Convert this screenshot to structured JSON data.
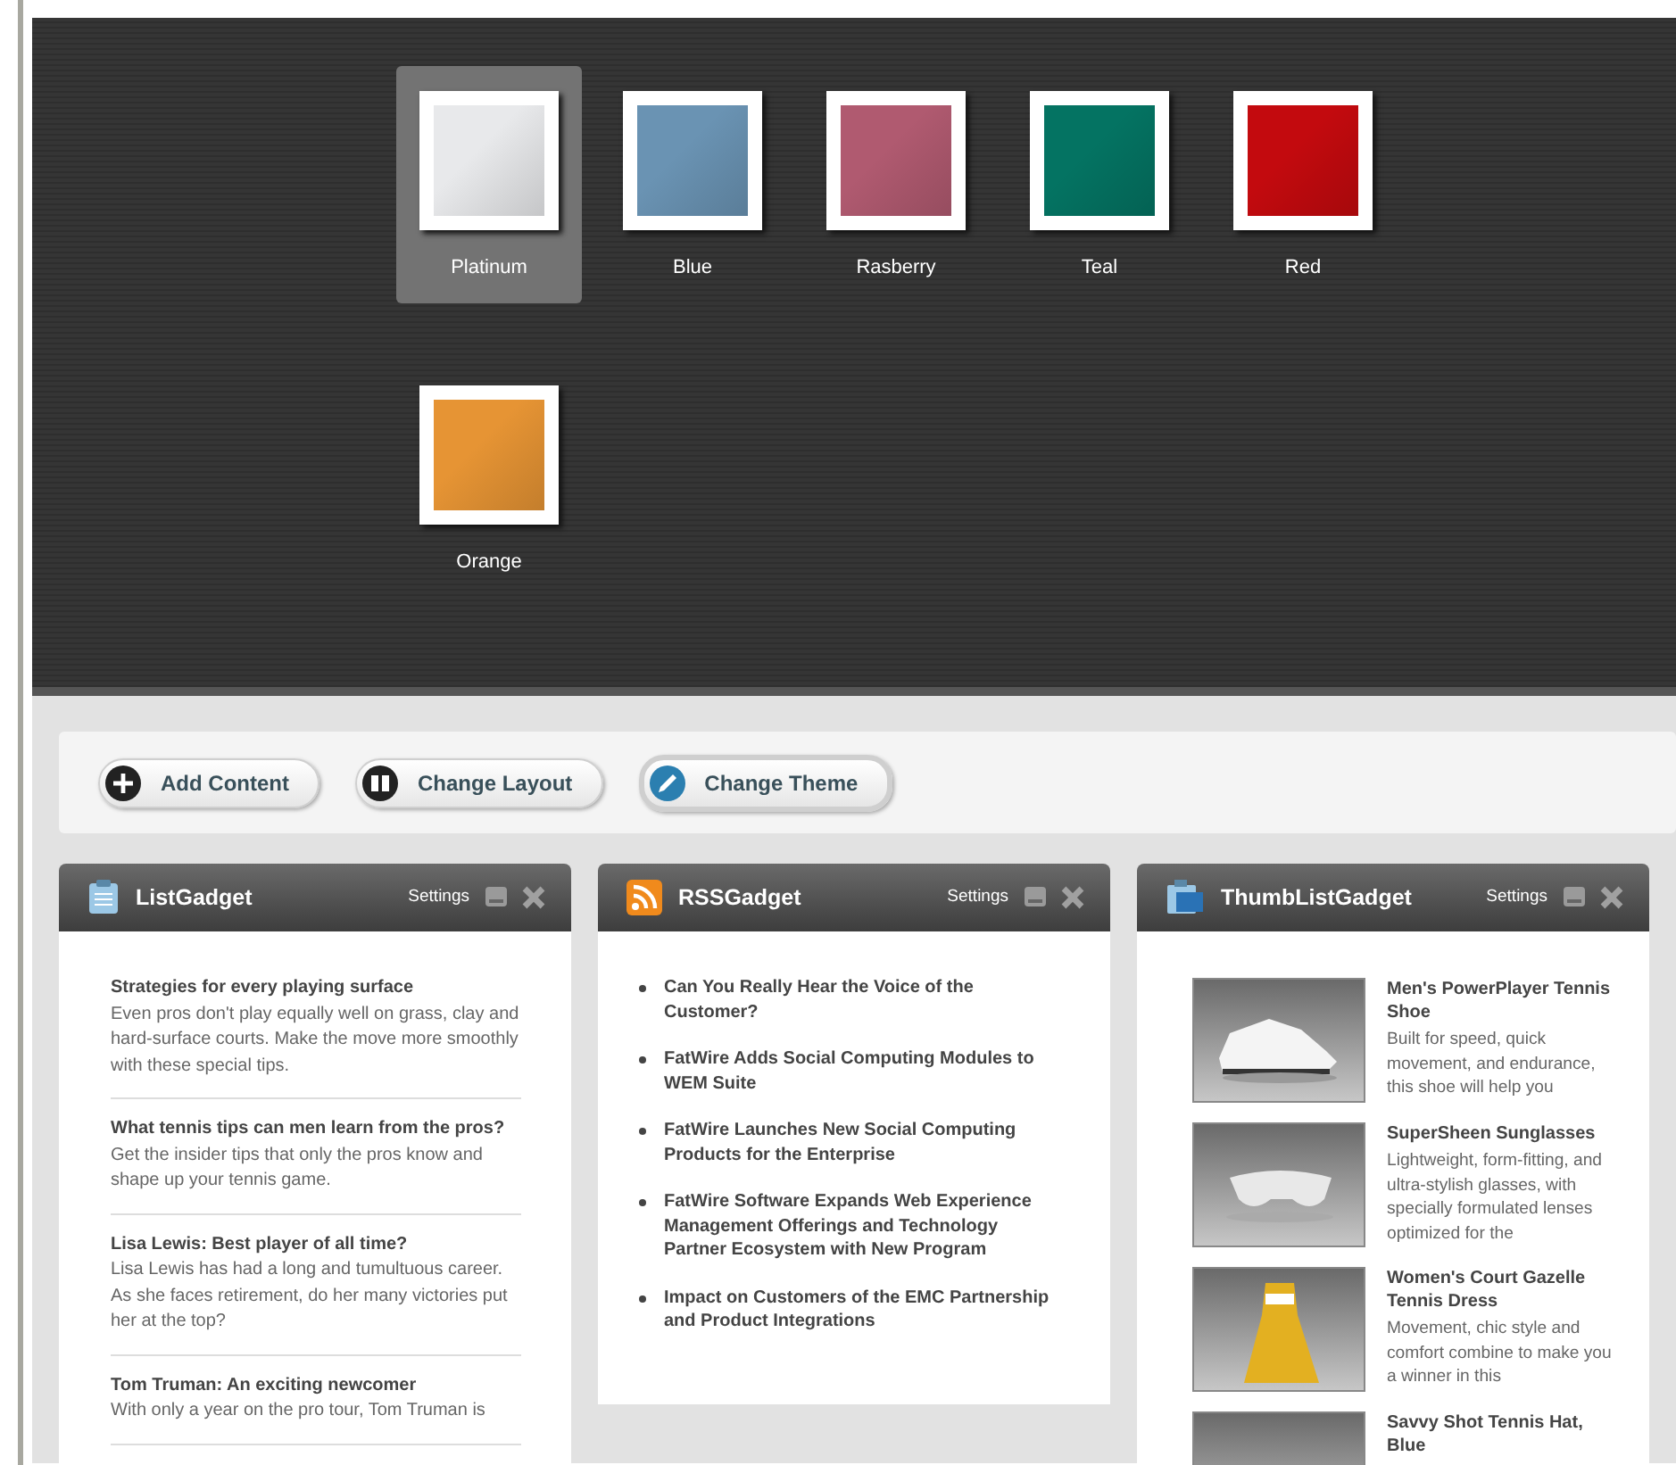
{
  "themes": [
    {
      "label": "Platinum",
      "color": "#e8e9eb",
      "selected": true
    },
    {
      "label": "Blue",
      "color": "#6a93b3",
      "selected": false
    },
    {
      "label": "Rasberry",
      "color": "#b05a70",
      "selected": false
    },
    {
      "label": "Teal",
      "color": "#047362",
      "selected": false
    },
    {
      "label": "Red",
      "color": "#c30a0e",
      "selected": false
    },
    {
      "label": "Orange",
      "color": "#e69434",
      "selected": false
    }
  ],
  "toolbar": [
    {
      "label": "Add Content",
      "selected": false
    },
    {
      "label": "Change Layout",
      "selected": false
    },
    {
      "label": "Change Theme",
      "selected": true
    }
  ],
  "gadgets": [
    {
      "kind": "list",
      "title": "ListGadget",
      "settings": "Settings",
      "items": [
        {
          "title": "Strategies for every playing surface",
          "text": "Even pros don't play equally well on grass, clay and hard-surface courts. Make the move more smoothly with these special tips."
        },
        {
          "title": "What tennis tips can men learn from the pros?",
          "text": "Get the insider tips that only the pros know and shape up your tennis game."
        },
        {
          "title": "Lisa Lewis: Best player of all time?",
          "text": "Lisa Lewis has had a long and tumultuous career. As she faces retirement, do her many victories put her at the top?"
        },
        {
          "title": "Tom Truman: An exciting newcomer",
          "text": "With only a year on the pro tour, Tom Truman is"
        }
      ]
    },
    {
      "kind": "rss",
      "title": "RSSGadget",
      "settings": "Settings",
      "items": [
        {
          "title": "Can You Really Hear the Voice of the Customer?"
        },
        {
          "title": "FatWire Adds Social Computing Modules to WEM Suite"
        },
        {
          "title": "FatWire Launches New Social Computing Products for the Enterprise"
        },
        {
          "title": "FatWire Software Expands Web Experience Management Offerings and Technology Partner Ecosystem with New Program"
        },
        {
          "title": "Impact on Customers of the EMC Partnership and Product Integrations"
        }
      ]
    },
    {
      "kind": "thumbs",
      "title": "ThumbListGadget",
      "settings": "Settings",
      "items": [
        {
          "title": "Men's PowerPlayer Tennis Shoe",
          "text": "Built for speed, quick movement, and endurance, this shoe will help you"
        },
        {
          "title": "SuperSheen Sunglasses",
          "text": "Lightweight, form-fitting, and ultra-stylish glasses, with specially formulated lenses optimized for the"
        },
        {
          "title": "Women's Court Gazelle Tennis Dress",
          "text": "Movement, chic style and comfort combine to make you a winner in this"
        },
        {
          "title": "Savvy Shot Tennis Hat, Blue"
        }
      ]
    }
  ]
}
